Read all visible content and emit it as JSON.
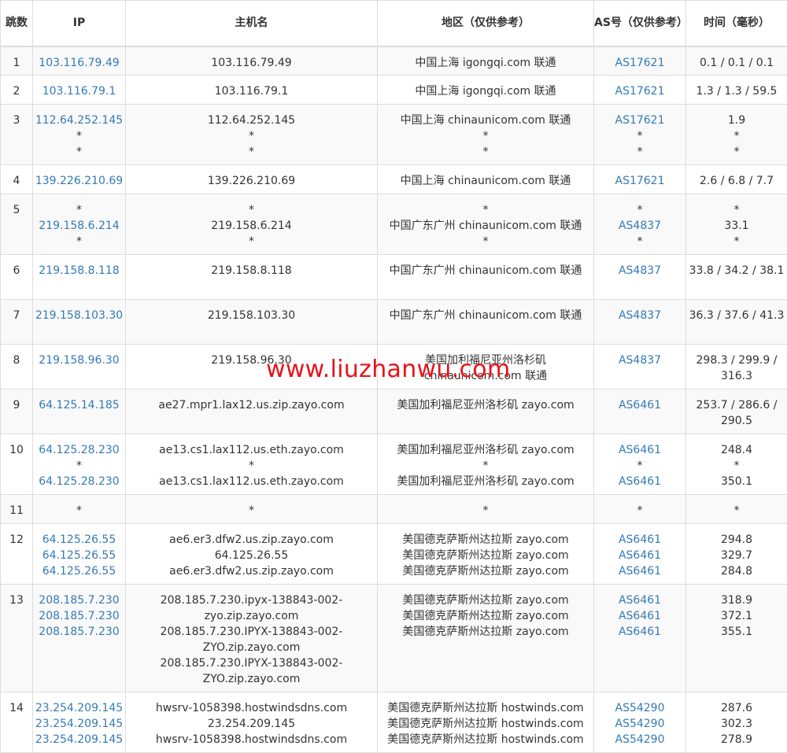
{
  "headers": {
    "hop": "跳数",
    "ip": "IP",
    "host": "主机名",
    "region": "地区（仅供参考）",
    "as": "AS号（仅供参考）",
    "time": "时间（毫秒）"
  },
  "rows": [
    {
      "hop": "1",
      "ip": [
        "103.116.79.49"
      ],
      "host": [
        "103.116.79.49"
      ],
      "region": [
        "中国上海 igongqi.com 联通"
      ],
      "as": [
        "AS17621"
      ],
      "time": [
        "0.1 / 0.1 / 0.1"
      ]
    },
    {
      "hop": "2",
      "ip": [
        "103.116.79.1"
      ],
      "host": [
        "103.116.79.1"
      ],
      "region": [
        "中国上海 igongqi.com 联通"
      ],
      "as": [
        "AS17621"
      ],
      "time": [
        "1.3 / 1.3 / 59.5"
      ]
    },
    {
      "hop": "3",
      "ip": [
        "112.64.252.145",
        "*",
        "*"
      ],
      "host": [
        "112.64.252.145",
        "*",
        "*"
      ],
      "region": [
        "中国上海 chinaunicom.com 联通",
        "*",
        "*"
      ],
      "as": [
        "AS17621",
        "*",
        "*"
      ],
      "time": [
        "1.9",
        "*",
        "*"
      ]
    },
    {
      "hop": "4",
      "ip": [
        "139.226.210.69"
      ],
      "host": [
        "139.226.210.69"
      ],
      "region": [
        "中国上海 chinaunicom.com 联通"
      ],
      "as": [
        "AS17621"
      ],
      "time": [
        "2.6 / 6.8 / 7.7"
      ]
    },
    {
      "hop": "5",
      "ip": [
        "*",
        "219.158.6.214",
        "*"
      ],
      "host": [
        "*",
        "219.158.6.214",
        "*"
      ],
      "region": [
        "*",
        "中国广东广州 chinaunicom.com 联通",
        "*"
      ],
      "as": [
        "*",
        "AS4837",
        "*"
      ],
      "time": [
        "*",
        "33.1",
        "*"
      ]
    },
    {
      "hop": "6",
      "ip": [
        "219.158.8.118"
      ],
      "host": [
        "219.158.8.118"
      ],
      "region": [
        "中国广东广州 chinaunicom.com 联通"
      ],
      "as": [
        "AS4837"
      ],
      "time": [
        "33.8 / 34.2 / 38.1"
      ]
    },
    {
      "hop": "7",
      "ip": [
        "219.158.103.30"
      ],
      "host": [
        "219.158.103.30"
      ],
      "region": [
        "中国广东广州 chinaunicom.com 联通"
      ],
      "as": [
        "AS4837"
      ],
      "time": [
        "36.3 / 37.6 / 41.3"
      ]
    },
    {
      "hop": "8",
      "ip": [
        "219.158.96.30"
      ],
      "host": [
        "219.158.96.30"
      ],
      "region": [
        "美国加利福尼亚州洛杉矶 chinaunicom.com 联通"
      ],
      "as": [
        "AS4837"
      ],
      "time": [
        "298.3 / 299.9 / 316.3"
      ]
    },
    {
      "hop": "9",
      "ip": [
        "64.125.14.185"
      ],
      "host": [
        "ae27.mpr1.lax12.us.zip.zayo.com"
      ],
      "region": [
        "美国加利福尼亚州洛杉矶 zayo.com"
      ],
      "as": [
        "AS6461"
      ],
      "time": [
        "253.7 / 286.6 / 290.5"
      ]
    },
    {
      "hop": "10",
      "ip": [
        "64.125.28.230",
        "*",
        "64.125.28.230"
      ],
      "host": [
        "ae13.cs1.lax112.us.eth.zayo.com",
        "*",
        "ae13.cs1.lax112.us.eth.zayo.com"
      ],
      "region": [
        "美国加利福尼亚州洛杉矶 zayo.com",
        "*",
        "美国加利福尼亚州洛杉矶 zayo.com"
      ],
      "as": [
        "AS6461",
        "*",
        "AS6461"
      ],
      "time": [
        "248.4",
        "*",
        "350.1"
      ]
    },
    {
      "hop": "11",
      "ip": [
        "*"
      ],
      "host": [
        "*"
      ],
      "region": [
        "*"
      ],
      "as": [
        "*"
      ],
      "time": [
        "*"
      ]
    },
    {
      "hop": "12",
      "ip": [
        "64.125.26.55",
        "64.125.26.55",
        "64.125.26.55"
      ],
      "host": [
        "ae6.er3.dfw2.us.zip.zayo.com",
        "64.125.26.55",
        "ae6.er3.dfw2.us.zip.zayo.com"
      ],
      "region": [
        "美国德克萨斯州达拉斯 zayo.com",
        "美国德克萨斯州达拉斯 zayo.com",
        "美国德克萨斯州达拉斯 zayo.com"
      ],
      "as": [
        "AS6461",
        "AS6461",
        "AS6461"
      ],
      "time": [
        "294.8",
        "329.7",
        "284.8"
      ]
    },
    {
      "hop": "13",
      "ip": [
        "208.185.7.230",
        "208.185.7.230",
        "208.185.7.230"
      ],
      "host": [
        "208.185.7.230.ipyx-138843-002-zyo.zip.zayo.com",
        "208.185.7.230.IPYX-138843-002-ZYO.zip.zayo.com",
        "208.185.7.230.IPYX-138843-002-ZYO.zip.zayo.com"
      ],
      "region": [
        "美国德克萨斯州达拉斯 zayo.com",
        "美国德克萨斯州达拉斯 zayo.com",
        "美国德克萨斯州达拉斯 zayo.com"
      ],
      "as": [
        "AS6461",
        "AS6461",
        "AS6461"
      ],
      "time": [
        "318.9",
        "372.1",
        "355.1"
      ]
    },
    {
      "hop": "14",
      "ip": [
        "23.254.209.145",
        "23.254.209.145",
        "23.254.209.145"
      ],
      "host": [
        "hwsrv-1058398.hostwindsdns.com",
        "23.254.209.145",
        "hwsrv-1058398.hostwindsdns.com"
      ],
      "region": [
        "美国德克萨斯州达拉斯 hostwinds.com",
        "美国德克萨斯州达拉斯 hostwinds.com",
        "美国德克萨斯州达拉斯 hostwinds.com"
      ],
      "as": [
        "AS54290",
        "AS54290",
        "AS54290"
      ],
      "time": [
        "287.6",
        "302.3",
        "278.9"
      ]
    }
  ],
  "watermark": "www.liuzhanwu.com",
  "colors": {
    "link": "#337ab7",
    "watermark": "#e8121a",
    "stripe": "#f9f9f9",
    "border": "#dddddd"
  }
}
